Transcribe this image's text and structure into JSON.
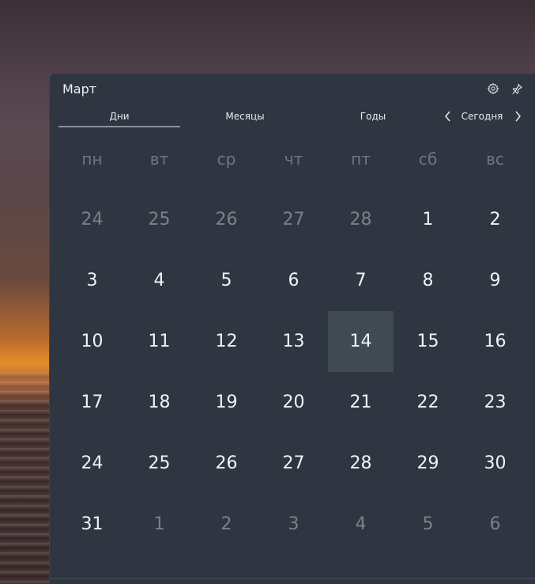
{
  "window": {
    "title": "Март"
  },
  "header": {
    "settings_icon": "gear-icon",
    "pin_icon": "pin-icon"
  },
  "tabs": [
    {
      "label": "Дни",
      "active": true
    },
    {
      "label": "Месяцы",
      "active": false
    },
    {
      "label": "Годы",
      "active": false
    }
  ],
  "navigation": {
    "today_label": "Сегодня",
    "prev_icon": "chevron-left-icon",
    "next_icon": "chevron-right-icon"
  },
  "weekdays": [
    "пн",
    "вт",
    "ср",
    "чт",
    "пт",
    "сб",
    "вс"
  ],
  "days": [
    {
      "label": "24",
      "current": false
    },
    {
      "label": "25",
      "current": false
    },
    {
      "label": "26",
      "current": false
    },
    {
      "label": "27",
      "current": false
    },
    {
      "label": "28",
      "current": false
    },
    {
      "label": "1",
      "current": true
    },
    {
      "label": "2",
      "current": true
    },
    {
      "label": "3",
      "current": true
    },
    {
      "label": "4",
      "current": true
    },
    {
      "label": "5",
      "current": true
    },
    {
      "label": "6",
      "current": true
    },
    {
      "label": "7",
      "current": true
    },
    {
      "label": "8",
      "current": true
    },
    {
      "label": "9",
      "current": true
    },
    {
      "label": "10",
      "current": true
    },
    {
      "label": "11",
      "current": true
    },
    {
      "label": "12",
      "current": true
    },
    {
      "label": "13",
      "current": true
    },
    {
      "label": "14",
      "current": true,
      "today": true
    },
    {
      "label": "15",
      "current": true
    },
    {
      "label": "16",
      "current": true
    },
    {
      "label": "17",
      "current": true
    },
    {
      "label": "18",
      "current": true
    },
    {
      "label": "19",
      "current": true
    },
    {
      "label": "20",
      "current": true
    },
    {
      "label": "21",
      "current": true
    },
    {
      "label": "22",
      "current": true
    },
    {
      "label": "23",
      "current": true
    },
    {
      "label": "24",
      "current": true
    },
    {
      "label": "25",
      "current": true
    },
    {
      "label": "26",
      "current": true
    },
    {
      "label": "27",
      "current": true
    },
    {
      "label": "28",
      "current": true
    },
    {
      "label": "29",
      "current": true
    },
    {
      "label": "30",
      "current": true
    },
    {
      "label": "31",
      "current": true
    },
    {
      "label": "1",
      "current": false
    },
    {
      "label": "2",
      "current": false
    },
    {
      "label": "3",
      "current": false
    },
    {
      "label": "4",
      "current": false
    },
    {
      "label": "5",
      "current": false
    },
    {
      "label": "6",
      "current": false
    }
  ],
  "colors": {
    "panel_bg": "#2f3541",
    "today_bg": "#3f4a52",
    "muted_text": "#7a818c"
  }
}
